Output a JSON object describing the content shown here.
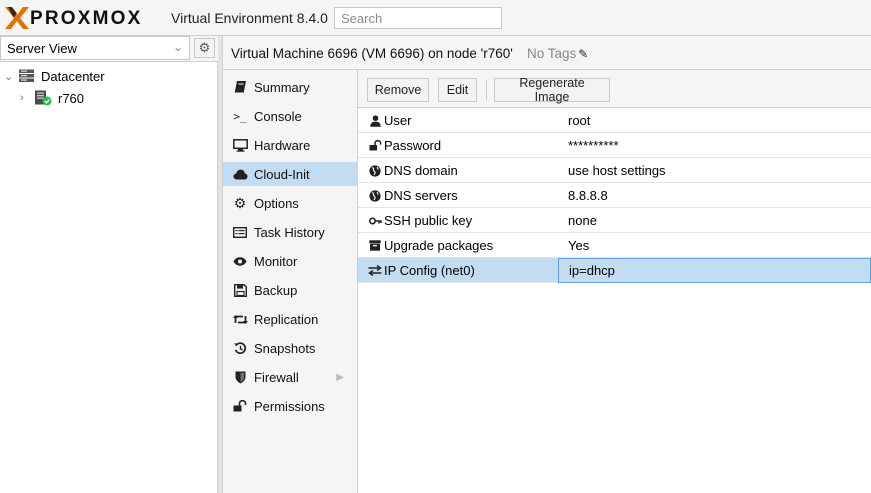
{
  "header": {
    "logo_text": "PROXMOX",
    "app_title": "Virtual Environment 8.4.0",
    "search_placeholder": "Search"
  },
  "left_panel": {
    "view_select": "Server View",
    "tree": [
      {
        "label": "Datacenter",
        "icon": "datacenter-icon",
        "expanded": true
      },
      {
        "label": "r760",
        "icon": "node-online-icon",
        "expanded": false
      }
    ]
  },
  "content_header": {
    "title": "Virtual Machine 6696 (VM 6696) on node 'r760'",
    "tags": "No Tags"
  },
  "nav": {
    "items": [
      {
        "label": "Summary",
        "icon": "book-icon"
      },
      {
        "label": "Console",
        "icon": "terminal-icon"
      },
      {
        "label": "Hardware",
        "icon": "desktop-icon"
      },
      {
        "label": "Cloud-Init",
        "icon": "cloud-icon",
        "active": true
      },
      {
        "label": "Options",
        "icon": "gear-icon"
      },
      {
        "label": "Task History",
        "icon": "list-icon"
      },
      {
        "label": "Monitor",
        "icon": "eye-icon"
      },
      {
        "label": "Backup",
        "icon": "floppy-icon"
      },
      {
        "label": "Replication",
        "icon": "retweet-icon"
      },
      {
        "label": "Snapshots",
        "icon": "history-icon"
      },
      {
        "label": "Firewall",
        "icon": "shield-icon",
        "has_submenu": true
      },
      {
        "label": "Permissions",
        "icon": "unlock-icon"
      }
    ]
  },
  "toolbar": {
    "remove_label": "Remove",
    "edit_label": "Edit",
    "regenerate_label": "Regenerate Image"
  },
  "cloudinit": {
    "rows": [
      {
        "key": "User",
        "value": "root",
        "icon": "user-icon"
      },
      {
        "key": "Password",
        "value": "**********",
        "icon": "unlock-icon"
      },
      {
        "key": "DNS domain",
        "value": "use host settings",
        "icon": "globe-icon"
      },
      {
        "key": "DNS servers",
        "value": "8.8.8.8",
        "icon": "globe-icon"
      },
      {
        "key": "SSH public key",
        "value": "none",
        "icon": "key-icon"
      },
      {
        "key": "Upgrade packages",
        "value": "Yes",
        "icon": "archive-icon"
      },
      {
        "key": "IP Config (net0)",
        "value": "ip=dhcp",
        "icon": "exchange-icon",
        "selected": true
      }
    ]
  },
  "colors": {
    "brand_orange": "#e57000",
    "selection": "#c2ddf2",
    "selection_border": "#5fa2dd",
    "status_green": "#21bf4b"
  }
}
